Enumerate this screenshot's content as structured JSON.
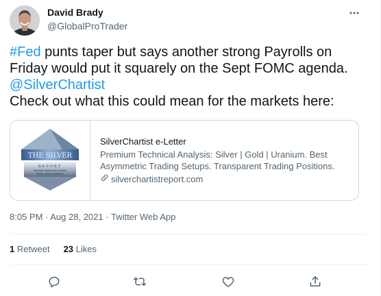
{
  "author": {
    "name": "David Brady",
    "handle": "@GlobalProTrader"
  },
  "tweet": {
    "hashtag": "#Fed",
    "line1_rest": " punts taper but says another strong Payrolls on",
    "line2": "Friday would put it squarely on the Sept FOMC agenda.",
    "mention": "@SilverChartist",
    "line4": "Check out what this could mean for the markets here:"
  },
  "card": {
    "site": "SilverChartist e-Letter",
    "description": "Premium Technical Analysis: Silver | Gold | Uranium. Best Asymmetric Trading Setups. Transparent Trading Positions.",
    "url": "silverchartistreport.com",
    "thumb": {
      "title": "THE SILVER",
      "subtitle": "REPORT",
      "tagline": "Premium Technical Analysis",
      "metals": "Silver | Gold | Uranium"
    }
  },
  "meta": {
    "time": "8:05 PM",
    "date": "Aug 28, 2021",
    "separator": " · ",
    "source": "Twitter Web App"
  },
  "stats": {
    "retweets_count": "1",
    "retweets_label": "Retweet",
    "likes_count": "23",
    "likes_label": "Likes"
  },
  "icons": {
    "more": "more-icon",
    "reply": "reply-icon",
    "retweet": "retweet-icon",
    "like": "heart-icon",
    "share": "share-icon",
    "link": "link-icon"
  },
  "colors": {
    "link": "#1d9bf0",
    "text": "#0f1419",
    "secondary": "#536471",
    "border": "#cfd9de"
  }
}
